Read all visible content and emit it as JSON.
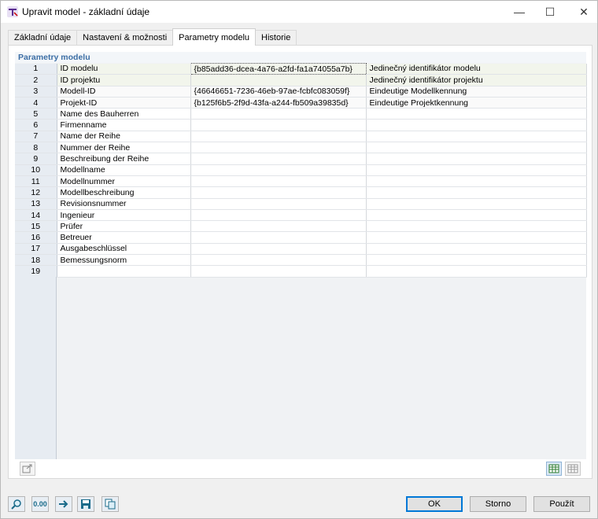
{
  "window": {
    "title": "Upravit model - základní údaje",
    "controls": {
      "minimize": "—",
      "maximize": "☐",
      "close": "✕"
    }
  },
  "tabs": [
    {
      "label": "Základní údaje",
      "active": false
    },
    {
      "label": "Nastavení & možnosti",
      "active": false
    },
    {
      "label": "Parametry modelu",
      "active": true
    },
    {
      "label": "Historie",
      "active": false
    }
  ],
  "section": {
    "title": "Parametry modelu"
  },
  "rows": [
    {
      "n": "1",
      "name": "ID modelu",
      "value": "{b85add36-dcea-4a76-a2fd-fa1a74055a7b}",
      "desc": "Jedinečný identifikátor modelu"
    },
    {
      "n": "2",
      "name": "ID projektu",
      "value": "",
      "desc": "Jedinečný identifikátor projektu"
    },
    {
      "n": "3",
      "name": "Modell-ID",
      "value": "{46646651-7236-46eb-97ae-fcbfc083059f}",
      "desc": "Eindeutige Modellkennung"
    },
    {
      "n": "4",
      "name": "Projekt-ID",
      "value": "{b125f6b5-2f9d-43fa-a244-fb509a39835d}",
      "desc": "Eindeutige Projektkennung"
    },
    {
      "n": "5",
      "name": "Name des Bauherren",
      "value": "",
      "desc": ""
    },
    {
      "n": "6",
      "name": "Firmenname",
      "value": "",
      "desc": ""
    },
    {
      "n": "7",
      "name": "Name der Reihe",
      "value": "",
      "desc": ""
    },
    {
      "n": "8",
      "name": "Nummer der Reihe",
      "value": "",
      "desc": ""
    },
    {
      "n": "9",
      "name": "Beschreibung der Reihe",
      "value": "",
      "desc": ""
    },
    {
      "n": "10",
      "name": "Modellname",
      "value": "",
      "desc": ""
    },
    {
      "n": "11",
      "name": "Modellnummer",
      "value": "",
      "desc": ""
    },
    {
      "n": "12",
      "name": "Modellbeschreibung",
      "value": "",
      "desc": ""
    },
    {
      "n": "13",
      "name": "Revisionsnummer",
      "value": "",
      "desc": ""
    },
    {
      "n": "14",
      "name": "Ingenieur",
      "value": "",
      "desc": ""
    },
    {
      "n": "15",
      "name": "Prüfer",
      "value": "",
      "desc": ""
    },
    {
      "n": "16",
      "name": "Betreuer",
      "value": "",
      "desc": ""
    },
    {
      "n": "17",
      "name": "Ausgabeschlüssel",
      "value": "",
      "desc": ""
    },
    {
      "n": "18",
      "name": "Bemessungsnorm",
      "value": "",
      "desc": ""
    },
    {
      "n": "19",
      "name": "",
      "value": "",
      "desc": ""
    }
  ],
  "footer": {
    "ok": "OK",
    "cancel": "Storno",
    "apply": "Použít",
    "units_icon_text": "0.00"
  },
  "colors": {
    "accent": "#0078d7",
    "section_title": "#3c6ea5"
  }
}
